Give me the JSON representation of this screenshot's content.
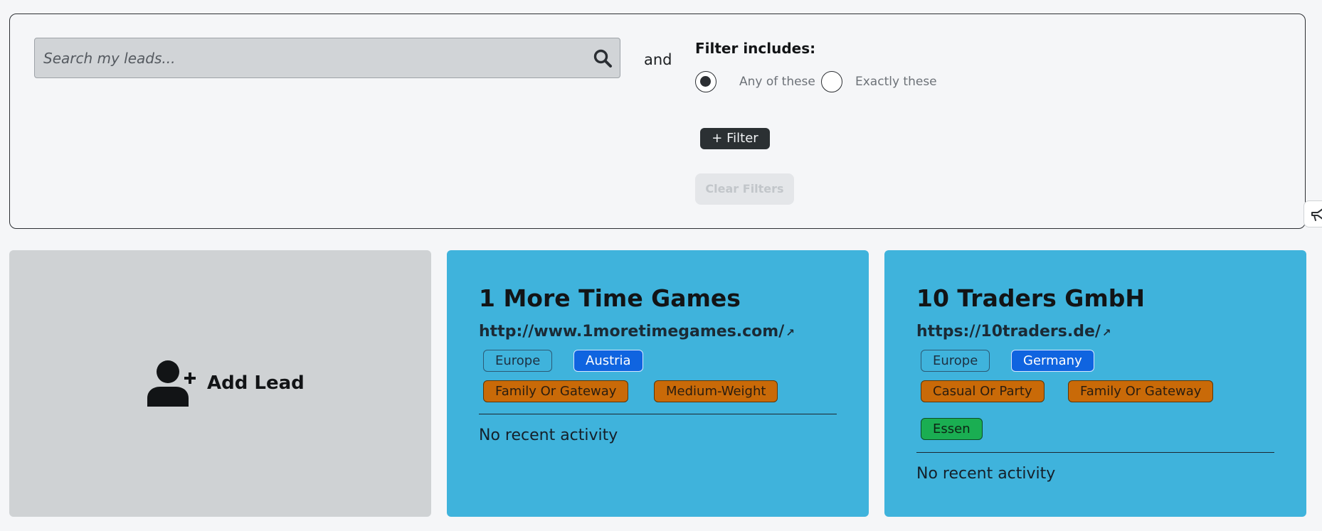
{
  "search": {
    "placeholder": "Search my leads..."
  },
  "filters": {
    "and_label": "and",
    "title": "Filter includes:",
    "options": [
      {
        "label": "Any of these",
        "selected": true
      },
      {
        "label": "Exactly these",
        "selected": false
      }
    ],
    "add_filter_label": "+ Filter",
    "clear_filters_label": "Clear Filters"
  },
  "add_lead": {
    "label": "Add Lead"
  },
  "leads": [
    {
      "name": "1 More Time Games",
      "url": "http://www.1moretimegames.com/",
      "url_icon": "external-link-icon",
      "tags": {
        "region": "Europe",
        "country": "Austria",
        "genres": [
          "Family Or Gateway",
          "Medium-Weight"
        ]
      },
      "activity": "No recent activity"
    },
    {
      "name": "10 Traders GmbH",
      "url": "https://10traders.de/",
      "url_icon": "external-link-icon",
      "tags": {
        "region": "Europe",
        "country": "Germany",
        "genres": [
          "Casual Or Party",
          "Family Or Gateway"
        ],
        "city": "Essen"
      },
      "activity": "No recent activity"
    }
  ],
  "colors": {
    "card_blue": "#3fb3dc",
    "add_card_gray": "#cfd2d4",
    "country_tag": "#0f64e0",
    "genre_tag": "#c96a08",
    "city_tag": "#1aae52"
  }
}
